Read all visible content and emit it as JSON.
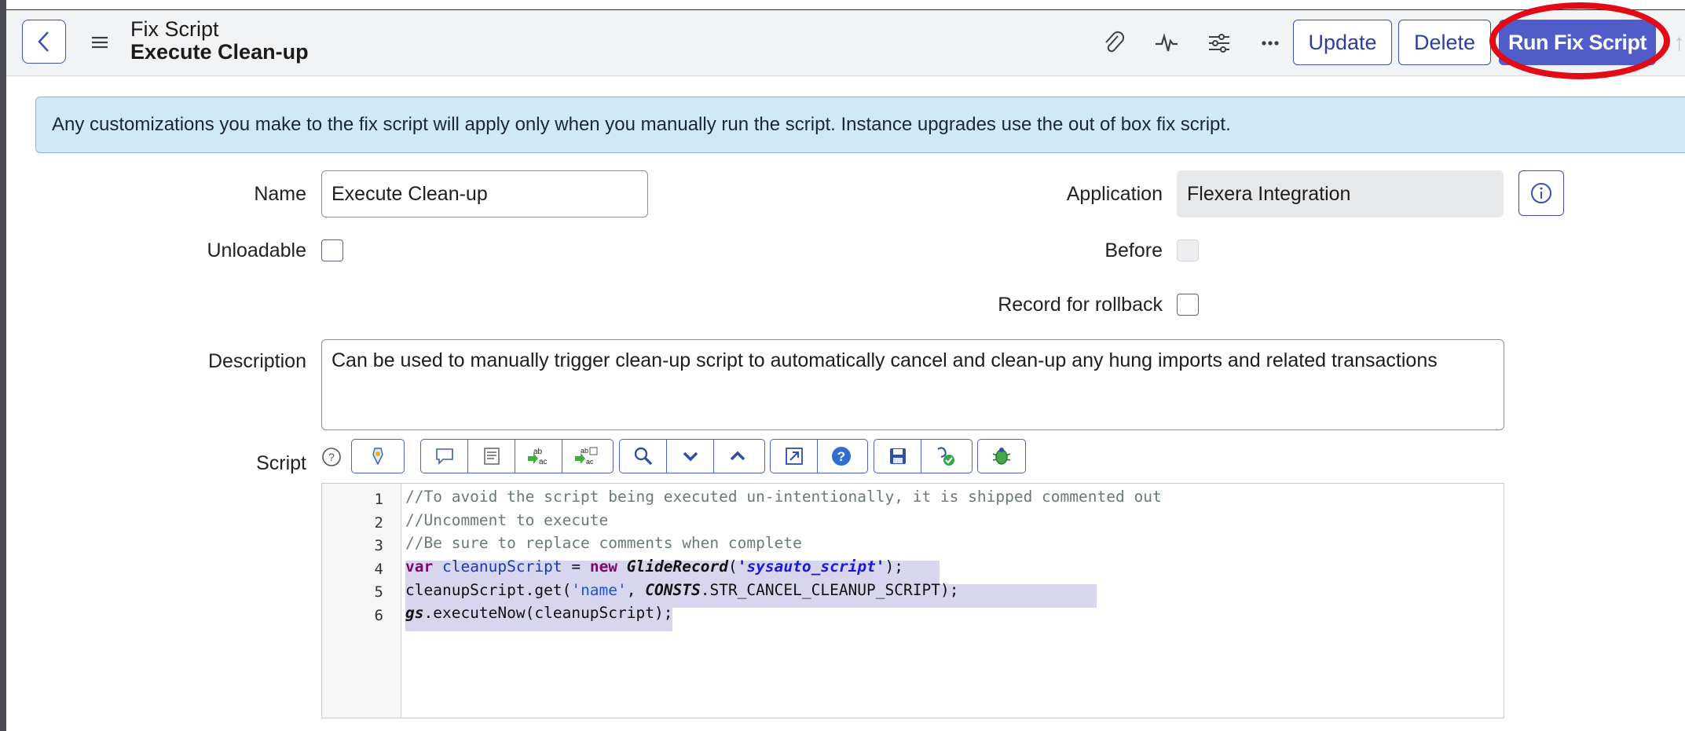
{
  "header": {
    "record_type": "Fix Script",
    "record_name": "Execute Clean-up",
    "update_label": "Update",
    "delete_label": "Delete",
    "run_label": "Run Fix Script"
  },
  "banner": {
    "text": "Any customizations you make to the fix script will apply only when you manually run the script. Instance upgrades use the out of box fix script."
  },
  "form": {
    "name_label": "Name",
    "name_value": "Execute Clean-up",
    "unloadable_label": "Unloadable",
    "unloadable_checked": false,
    "application_label": "Application",
    "application_value": "Flexera Integration",
    "before_label": "Before",
    "before_checked": false,
    "rollback_label": "Record for rollback",
    "rollback_checked": false,
    "description_label": "Description",
    "description_value": "Can be used to manually trigger clean-up script to automatically cancel and clean-up any hung imports and related transactions",
    "script_label": "Script"
  },
  "script": {
    "line_numbers": [
      "1",
      "2",
      "3",
      "4",
      "5",
      "6"
    ],
    "line1": "//To avoid the script being executed un-intentionally, it is shipped commented out",
    "line2": "//Uncomment to execute",
    "line3": "//Be sure to replace comments when complete",
    "line4": {
      "kw1": "var",
      "var": " cleanupScript ",
      "eq": "= ",
      "kw2": "new",
      "cls": " GlideRecord",
      "p1": "(",
      "str": "'sysauto_script'",
      "p2": ");"
    },
    "line5": {
      "a": "cleanupScript.get(",
      "str": "'name'",
      "b": ", ",
      "obj": "CONSTS",
      "c": ".STR_CANCEL_CLEANUP_SCRIPT);"
    },
    "line6": {
      "obj": "gs",
      "a": ".executeNow(cleanupScript);"
    }
  },
  "colors": {
    "accent": "#3c4fb8",
    "run_button": "#4f5cc9",
    "highlight_ring": "#e20a17",
    "banner_bg": "#cfe9f9"
  }
}
